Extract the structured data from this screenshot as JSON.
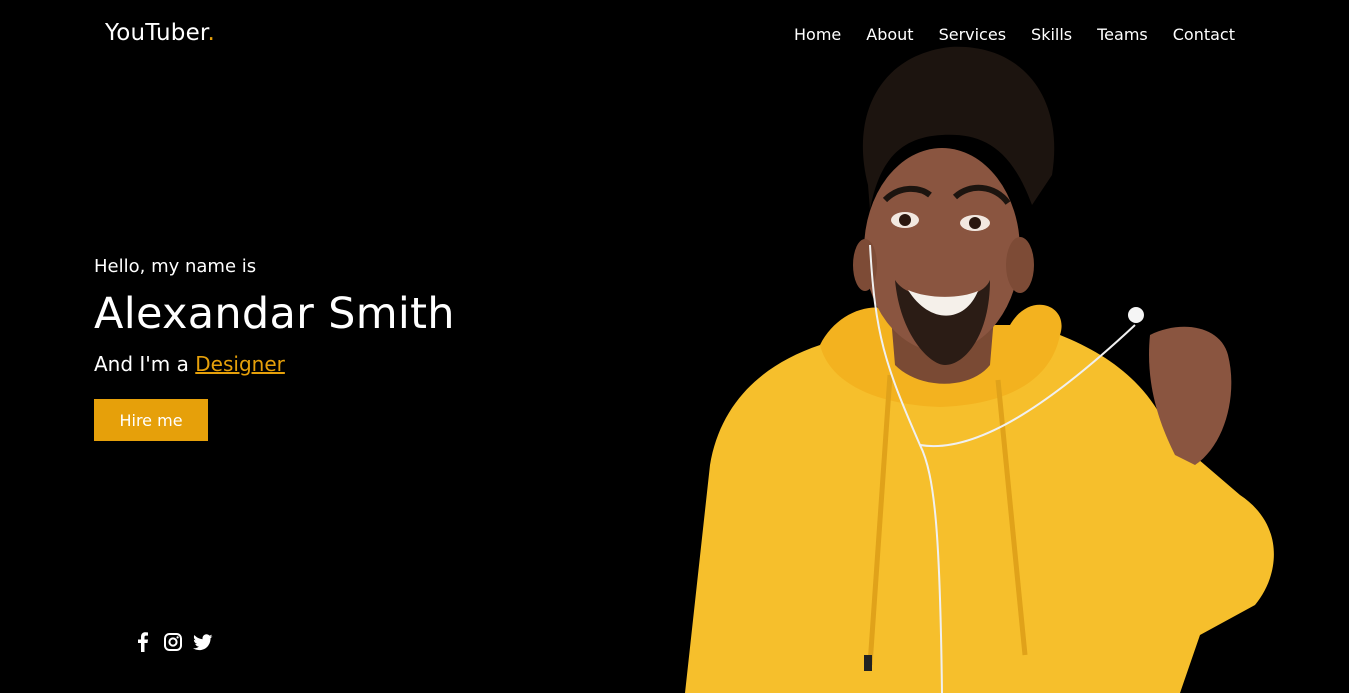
{
  "brand": {
    "name": "YouTuber",
    "dot": "."
  },
  "nav": {
    "items": [
      {
        "label": "Home"
      },
      {
        "label": "About"
      },
      {
        "label": "Services"
      },
      {
        "label": "Skills"
      },
      {
        "label": "Teams"
      },
      {
        "label": "Contact"
      }
    ]
  },
  "hero": {
    "greeting": "Hello, my name is",
    "name": "Alexandar Smith",
    "role_prefix": "And I'm a ",
    "role": "Designer",
    "cta_label": "Hire me"
  },
  "socials": [
    {
      "icon": "facebook-icon"
    },
    {
      "icon": "instagram-icon"
    },
    {
      "icon": "twitter-icon"
    }
  ],
  "colors": {
    "background": "#000000",
    "accent": "#e6a00a",
    "text": "#ffffff",
    "hoodie": "#f6bf2c"
  }
}
